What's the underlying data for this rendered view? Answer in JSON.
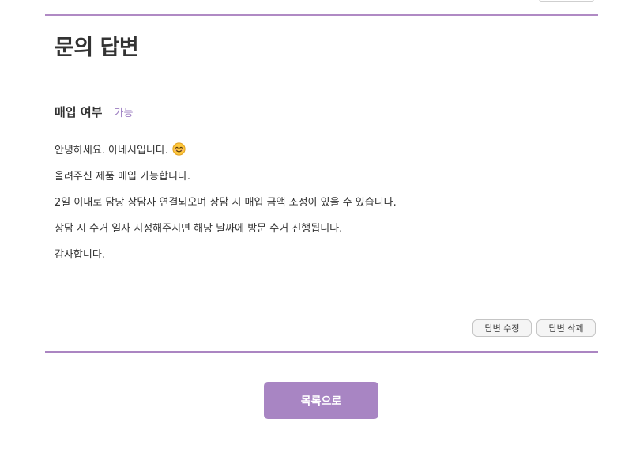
{
  "header": {
    "title": "문의 답변"
  },
  "purchase": {
    "label": "매입 여부",
    "value": "가능"
  },
  "answer": {
    "lines": [
      "안녕하세요. 아네시입니다.",
      "올려주신 제품 매입 가능합니다.",
      "2일 이내로 담당 상담사 연결되오며 상담 시 매입 금액 조정이 있을 수 있습니다.",
      "상담 시 수거 일자 지정해주시면 해당 날짜에 방문 수거 진행됩니다.",
      "감사합니다."
    ],
    "emoji_icon": "smiley-icon"
  },
  "actions": {
    "edit_label": "답변 수정",
    "delete_label": "답변 삭제"
  },
  "footer": {
    "list_button_label": "목록으로"
  },
  "colors": {
    "accent": "#a885c3",
    "value_text": "#9b7cc0",
    "rule": "#b08ac4"
  }
}
